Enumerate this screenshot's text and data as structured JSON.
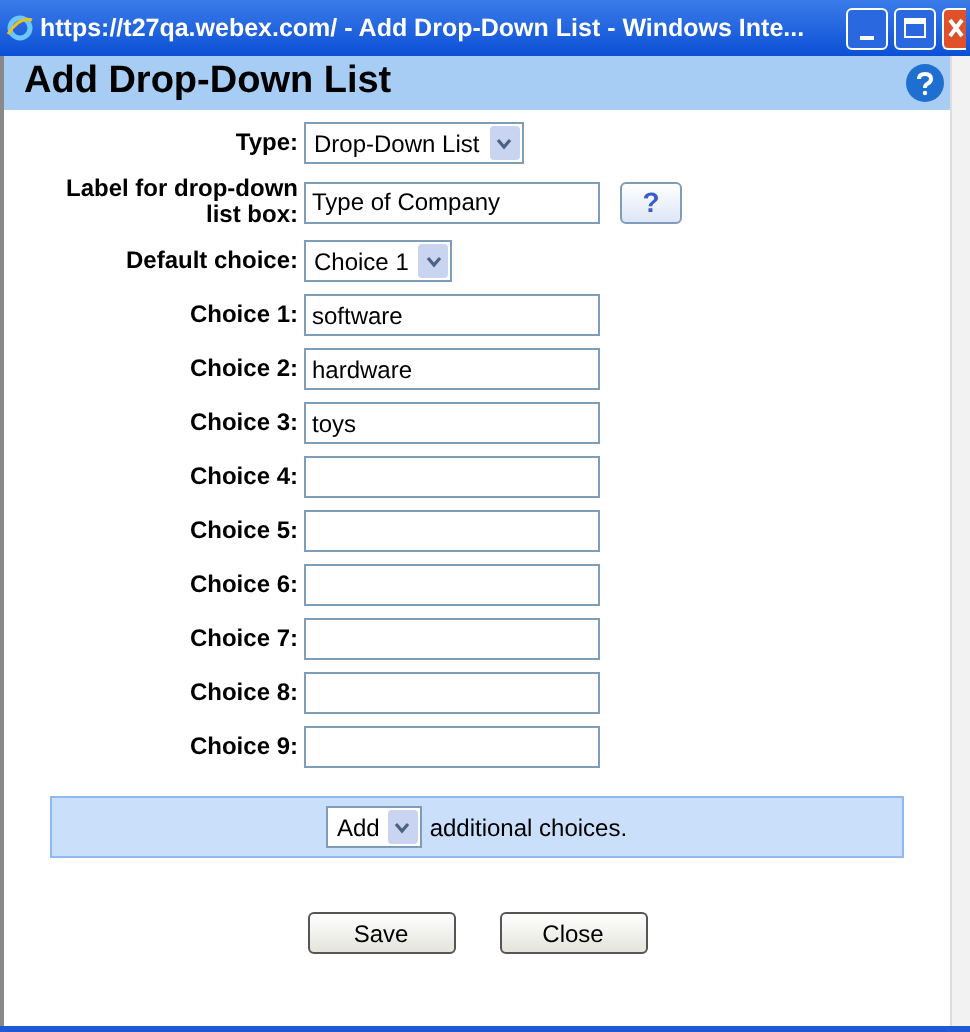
{
  "window": {
    "title": "https://t27qa.webex.com/ - Add Drop-Down List - Windows Inte..."
  },
  "dialog": {
    "title": "Add Drop-Down List"
  },
  "type": {
    "label": "Type:",
    "value": "Drop-Down List"
  },
  "list_label": {
    "label": "Label for drop-down list box:",
    "value": "Type of Company",
    "help": "?"
  },
  "default_choice": {
    "label": "Default choice:",
    "value": "Choice 1"
  },
  "choices": [
    {
      "label": "Choice 1:",
      "value": "software"
    },
    {
      "label": "Choice 2:",
      "value": "hardware"
    },
    {
      "label": "Choice 3:",
      "value": "toys"
    },
    {
      "label": "Choice 4:"
    },
    {
      "label": "Choice 5:"
    },
    {
      "label": "Choice 6:"
    },
    {
      "label": "Choice 7:"
    },
    {
      "label": "Choice 8:"
    },
    {
      "label": "Choice 9:"
    }
  ],
  "add_bar": {
    "select": "Add",
    "text": "additional choices."
  },
  "buttons": [
    "Save",
    "Close"
  ]
}
